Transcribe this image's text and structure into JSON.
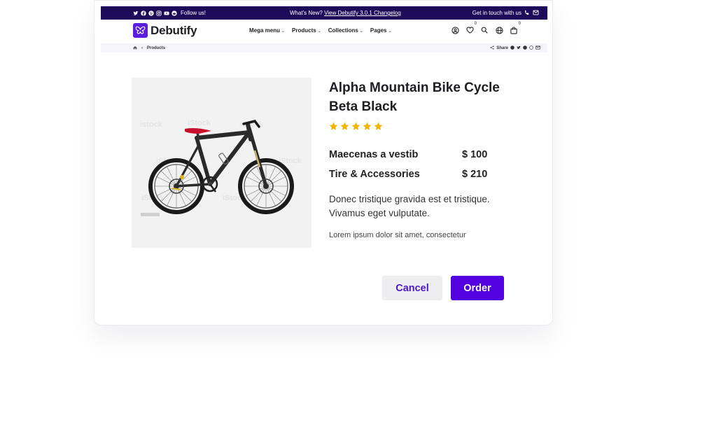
{
  "announcement": {
    "follow_label": "Follow us!",
    "news_label": "What's New?",
    "news_link": "View Debutify 3.0.1 Changelog",
    "contact_label": "Get in touch with us"
  },
  "header": {
    "brand": "Debutify",
    "nav": [
      "Mega menu",
      "Products",
      "Collections",
      "Pages"
    ],
    "wishlist_count": "0",
    "cart_count": "0"
  },
  "breadcrumb": {
    "current": "Products",
    "share_label": "Share"
  },
  "product": {
    "title": "Alpha Mountain Bike Cycle Beta Black",
    "rating": 5,
    "items": [
      {
        "name": "Maecenas a vestib",
        "price": "$ 100"
      },
      {
        "name": "Tire & Accessories",
        "price": "$ 210"
      }
    ],
    "description": "Donec tristique gravida est et tristique. Vivamus eget vulputate.",
    "note": "Lorem ipsum dolor sit amet, consectetur"
  },
  "actions": {
    "cancel": "Cancel",
    "order": "Order"
  },
  "colors": {
    "brand": "#5200e0",
    "announcement_bg": "#1d0a5b",
    "star": "#f5b301"
  }
}
